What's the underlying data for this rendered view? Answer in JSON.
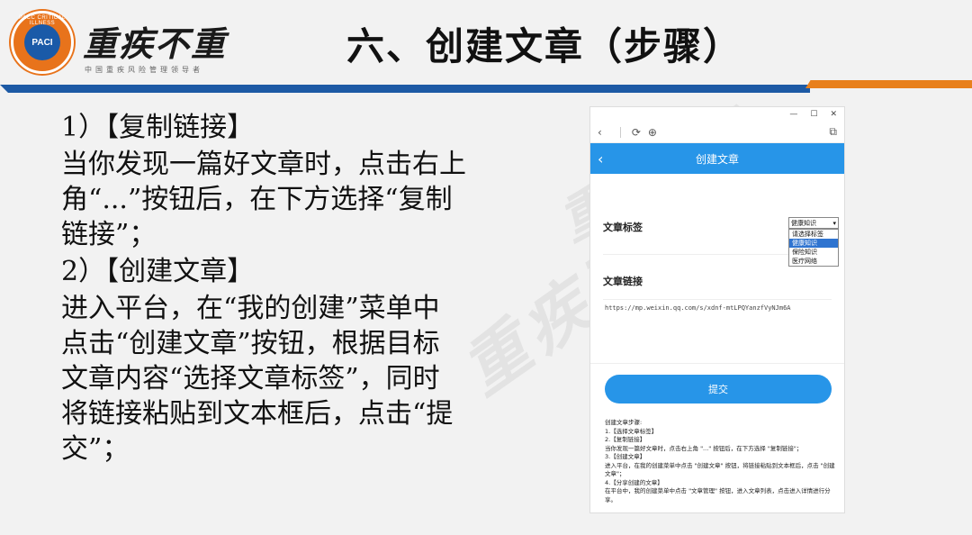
{
  "brand": {
    "ring_text": "PACC CRITICAL ILLNESS",
    "logo_text": "PACI",
    "name": "重疾不重",
    "subtitle": "中国重疾风险管理领导者",
    "colors": {
      "blue": "#1d5aa5",
      "orange": "#e8801c"
    }
  },
  "title": "六、创建文章（步骤）",
  "steps": [
    {
      "heading": "1）【复制链接】",
      "body": "当你发现一篇好文章时，点击右上角“...”按钮后，在下方选择“复制链接”；"
    },
    {
      "heading": "2）【创建文章】",
      "body": "进入平台，在“我的创建”菜单中点击“创建文章”按钮，根据目标文章内容“选择文章标签”，同时将链接粘贴到文本框后，点击“提交”；"
    }
  ],
  "watermark": "重疾不重",
  "phone": {
    "window_controls": [
      "—",
      "☐",
      "✕"
    ],
    "header_title": "创建文章",
    "tag_label": "文章标签",
    "tag_selected": "健康知识",
    "tag_options": [
      "请选择标签",
      "健康知识",
      "保险知识",
      "医疗网络"
    ],
    "link_label": "文章链接",
    "url": "https://mp.weixin.qq.com/s/xdnf-mtLPQYanzfVyNJm6A",
    "submit": "提交",
    "instructions": [
      "创建文章步骤:",
      "1.【选择文章标签】",
      "2.【复制链接】",
      "当你发现一篇好文章时，点击右上角 \"...\" 按钮后，在下方选择 \"复制链接\"；",
      "3.【创建文章】",
      "进入平台，在我的创建菜单中点击 \"创建文章\" 按钮，将链接粘贴到文本框后，点击 \"创建文章\"；",
      "4.【分享创建的文章】",
      "在平台中，我的创建菜单中点击 \"文章管理\" 按钮，进入文章列表，点击进入详情进行分享。"
    ]
  }
}
